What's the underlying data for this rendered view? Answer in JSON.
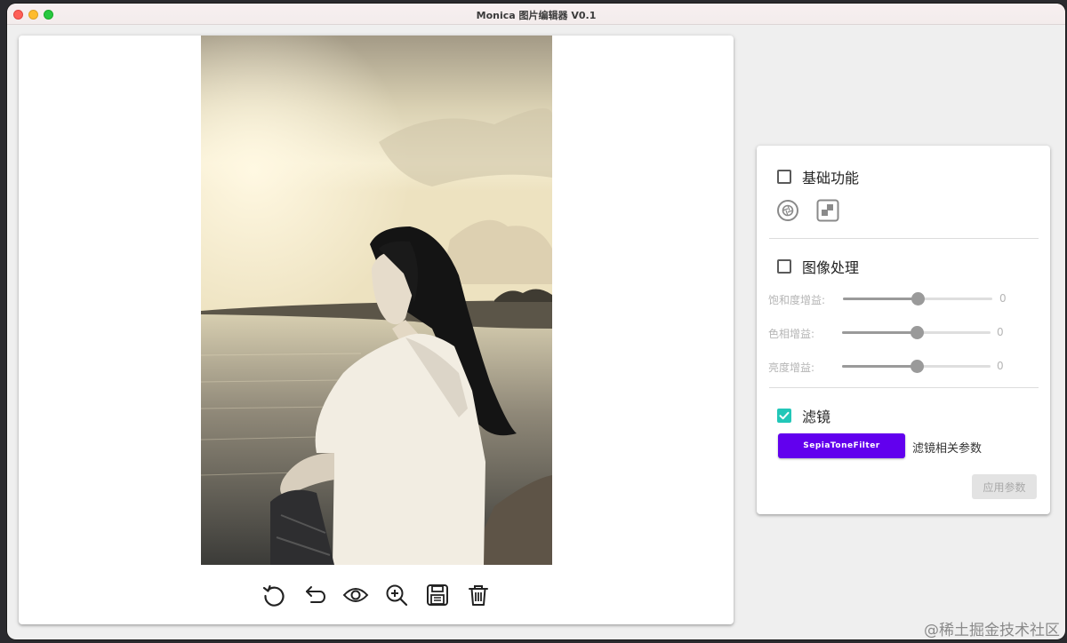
{
  "window": {
    "title": "Monica 图片编辑器 V0.1"
  },
  "canvas": {
    "toolbar": [
      {
        "icon": "rotate-icon"
      },
      {
        "icon": "undo-icon"
      },
      {
        "icon": "eye-icon"
      },
      {
        "icon": "zoom-in-icon"
      },
      {
        "icon": "save-icon"
      },
      {
        "icon": "trash-icon"
      }
    ]
  },
  "panel": {
    "basic": {
      "label": "基础功能",
      "checked": false
    },
    "image_processing": {
      "label": "图像处理",
      "checked": false,
      "sliders": [
        {
          "label": "饱和度增益:",
          "value": "0",
          "level": 0.5
        },
        {
          "label": "色相增益:",
          "value": "0",
          "level": 0.5
        },
        {
          "label": "亮度增益:",
          "value": "0",
          "level": 0.5
        }
      ]
    },
    "filter": {
      "label": "滤镜",
      "checked": true,
      "filter_button": "SepiaToneFilter",
      "params_label": "滤镜相关参数"
    },
    "apply_button": "应用参数"
  },
  "watermark": "@稀土掘金技术社区",
  "colors": {
    "accent": "#6200ee",
    "checkbox_checked": "#22c7b8"
  }
}
